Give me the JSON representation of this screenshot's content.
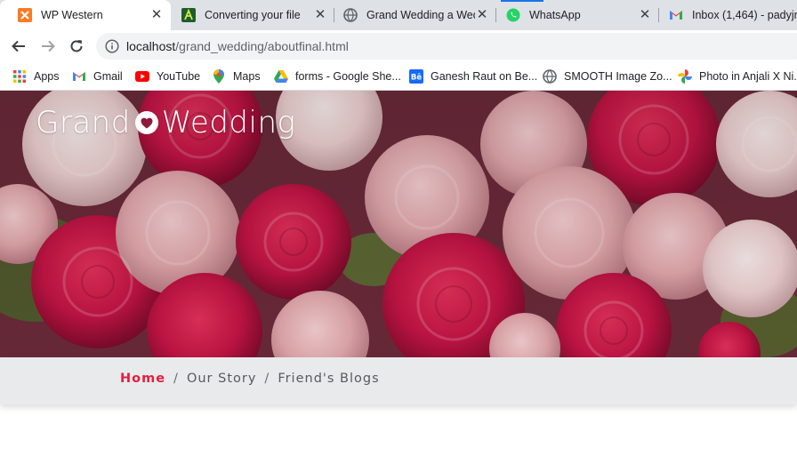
{
  "tabs": [
    {
      "title": "WP Western",
      "icon": "xampp-icon",
      "active": true
    },
    {
      "title": "Converting your file",
      "icon": "converter-icon",
      "active": false
    },
    {
      "title": "Grand Wedding a Wed",
      "icon": "globe-icon",
      "active": false
    },
    {
      "title": "WhatsApp",
      "icon": "whatsapp-icon",
      "active": false
    },
    {
      "title": "Inbox (1,464) - padyjr",
      "icon": "gmail-icon",
      "active": false
    }
  ],
  "toolbar": {
    "url_host": "localhost",
    "url_path": "/grand_wedding/aboutfinal.html"
  },
  "bookmarks": [
    {
      "label": "Apps",
      "icon": "apps-grid-icon"
    },
    {
      "label": "Gmail",
      "icon": "gmail-icon"
    },
    {
      "label": "YouTube",
      "icon": "youtube-icon"
    },
    {
      "label": "Maps",
      "icon": "maps-pin-icon"
    },
    {
      "label": "forms - Google She...",
      "icon": "google-drive-icon"
    },
    {
      "label": "Ganesh Raut on Be...",
      "icon": "behance-icon"
    },
    {
      "label": "SMOOTH Image Zo...",
      "icon": "globe-icon"
    },
    {
      "label": "Photo in Anjali X Ni...",
      "icon": "google-photos-icon"
    }
  ],
  "site": {
    "logo_left": "Grand",
    "logo_right": "Wedding",
    "logo_icon": "heart-icon"
  },
  "breadcrumb": {
    "items": [
      "Home",
      "Our Story",
      "Friend's Blogs"
    ],
    "separator": "/"
  },
  "colors": {
    "accent_home": "#e0203f",
    "breadcrumb_bg": "#e9eaec",
    "tabstrip_bg": "#dee1e6",
    "omnibox_bg": "#f1f3f4"
  }
}
